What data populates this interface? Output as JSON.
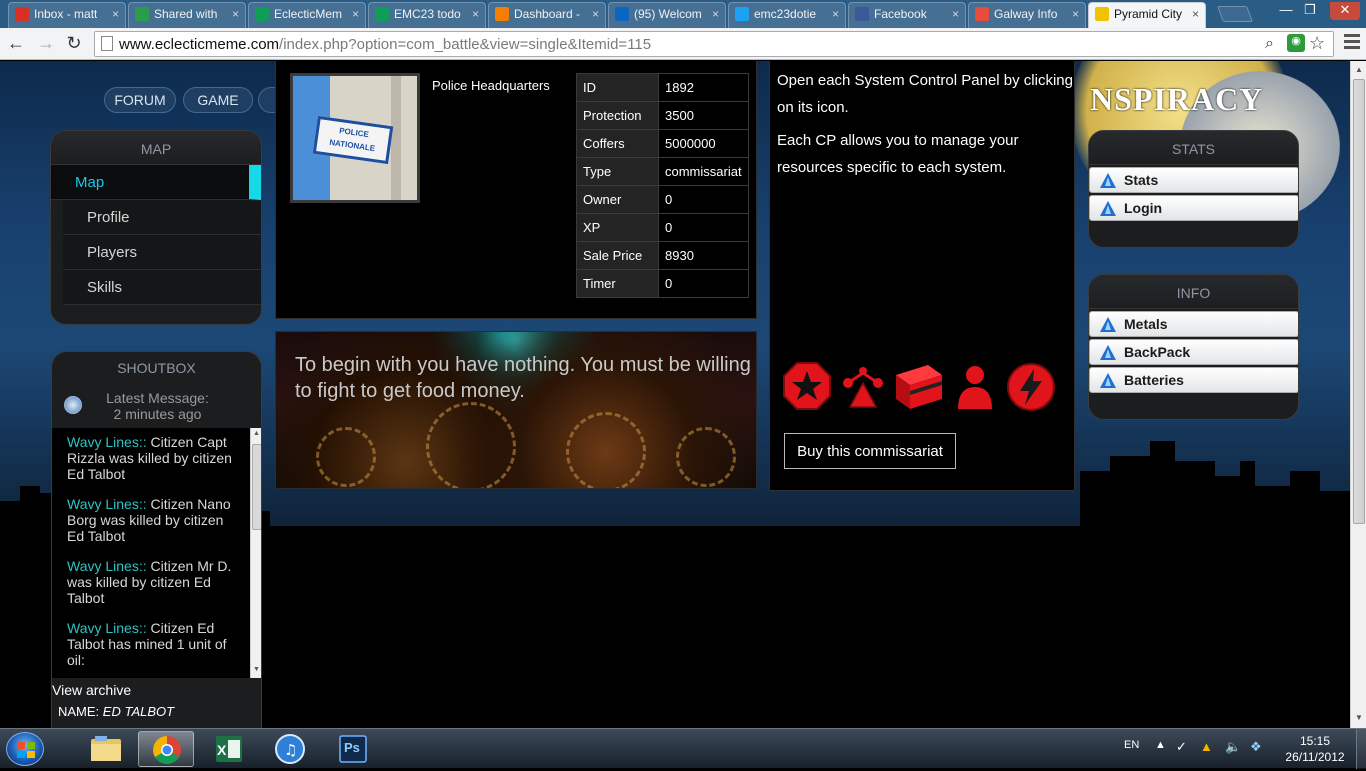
{
  "browser": {
    "tabs": [
      {
        "label": "Inbox - matt",
        "icon": "gmail-icon",
        "color": "#d93025"
      },
      {
        "label": "Shared with",
        "icon": "drive-icon",
        "color": "#2a9d4a"
      },
      {
        "label": "EclecticMem",
        "icon": "sheets-icon",
        "color": "#0f9d58"
      },
      {
        "label": "EMC23 todo",
        "icon": "sheets-icon",
        "color": "#0f9d58"
      },
      {
        "label": "Dashboard -",
        "icon": "blogger-icon",
        "color": "#f57d00"
      },
      {
        "label": "(95) Welcom",
        "icon": "linkedin-icon",
        "color": "#0a66c2"
      },
      {
        "label": "emc23dotie",
        "icon": "twitter-icon",
        "color": "#1da1f2"
      },
      {
        "label": "Facebook",
        "icon": "facebook-icon",
        "color": "#3b5998"
      },
      {
        "label": "Galway Info",
        "icon": "joomla-icon",
        "color": "#e84c3d"
      },
      {
        "label": "Pyramid City",
        "icon": "warning-icon",
        "color": "#f2c200"
      }
    ],
    "active_tab_index": 9,
    "url_host": "www.eclecticmeme.com",
    "url_path": "/index.php?option=com_battle&view=single&Itemid=115"
  },
  "nav": {
    "forum": "FORUM",
    "game": "GAME"
  },
  "map_panel": {
    "title": "MAP",
    "items": [
      "Map",
      "Profile",
      "Players",
      "Skills"
    ],
    "active_index": 0
  },
  "shoutbox": {
    "title": "SHOUTBOX",
    "latest_label": "Latest Message:",
    "latest_time": "2 minutes ago",
    "messages": [
      {
        "author": "Wavy Lines::",
        "text": " Citizen Capt Rizzla was killed by citizen Ed Talbot"
      },
      {
        "author": "Wavy Lines::",
        "text": " Citizen Nano Borg was killed by citizen Ed Talbot"
      },
      {
        "author": "Wavy Lines::",
        "text": " Citizen Mr D. was killed by citizen Ed Talbot"
      },
      {
        "author": "Wavy Lines::",
        "text": " Citizen Ed Talbot has mined 1 unit of oil:"
      }
    ],
    "view_archive": "View archive",
    "name_label": "NAME:",
    "name_value": "ED TALBOT"
  },
  "building": {
    "title": "Police Headquarters",
    "sign_line1": "POLICE",
    "sign_line2": "NATIONALE",
    "props": [
      {
        "k": "ID",
        "v": "1892"
      },
      {
        "k": "Protection",
        "v": "3500"
      },
      {
        "k": "Coffers",
        "v": "5000000"
      },
      {
        "k": "Type",
        "v": "commissariat"
      },
      {
        "k": "Owner",
        "v": "0"
      },
      {
        "k": "XP",
        "v": "0"
      },
      {
        "k": "Sale Price",
        "v": "8930"
      },
      {
        "k": "Timer",
        "v": "0"
      }
    ]
  },
  "banner": {
    "text": "To begin with you have nothing. You must be willing to fight to get food money."
  },
  "control": {
    "p1": "Open each System Control Panel by clicking on its icon.",
    "p2": "Each CP allows you to manage your resources specific to each system.",
    "icons": [
      "cp-star-icon",
      "cp-network-icon",
      "cp-box-icon",
      "cp-person-icon",
      "cp-power-icon"
    ],
    "buy_label": "Buy this commissariat"
  },
  "right": {
    "logo": "NSPIRACY",
    "stats_title": "STATS",
    "stats_items": [
      "Stats",
      "Login"
    ],
    "info_title": "INFO",
    "info_items": [
      "Metals",
      "BackPack",
      "Batteries"
    ]
  },
  "taskbar": {
    "lang": "EN",
    "time": "15:15",
    "date": "26/11/2012",
    "apps": [
      "explorer-icon",
      "chrome-icon",
      "excel-icon",
      "itunes-icon",
      "photoshop-icon"
    ],
    "ps_label": "Ps"
  },
  "colors": {
    "accent_cyan": "#17d8e6",
    "cp_red": "#e0141a"
  }
}
